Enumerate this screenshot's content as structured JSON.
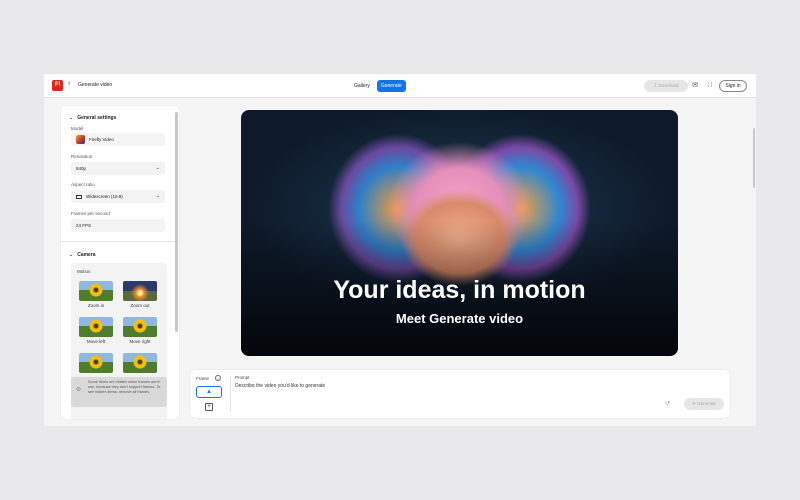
{
  "header": {
    "logo_text": "Fi",
    "back_icon": "chevron-left-icon",
    "title": "Generate video",
    "tabs": [
      {
        "label": "Gallery",
        "active": false
      },
      {
        "label": "Generate",
        "active": true
      }
    ],
    "download_label": "Download",
    "sign_in_label": "Sign in"
  },
  "sidebar": {
    "general": {
      "title": "General settings",
      "model_label": "Model",
      "model_value": "Firefly Video",
      "resolution_label": "Resolution",
      "resolution_value": "540p",
      "aspect_label": "Aspect ratio",
      "aspect_value": "Widescreen (16:9)",
      "fps_label": "Frames per second",
      "fps_value": "24 FPS"
    },
    "camera": {
      "title": "Camera",
      "motion_label": "Motion",
      "motions": [
        {
          "label": "Zoom in"
        },
        {
          "label": "Zoom out"
        },
        {
          "label": "Move left"
        },
        {
          "label": "Move right"
        }
      ]
    },
    "notice": "Some items are hidden when frames are in use, because they don't support frames. To see hidden items, remove all frames."
  },
  "hero": {
    "title": "Your ideas, in motion",
    "subtitle": "Meet Generate video"
  },
  "prompt": {
    "frame_label": "Frame",
    "prompt_label": "Prompt",
    "placeholder": "Describe the video you'd like to generate",
    "generate_label": "Generate"
  },
  "colors": {
    "accent": "#1473e6",
    "logo": "#e1251b"
  }
}
